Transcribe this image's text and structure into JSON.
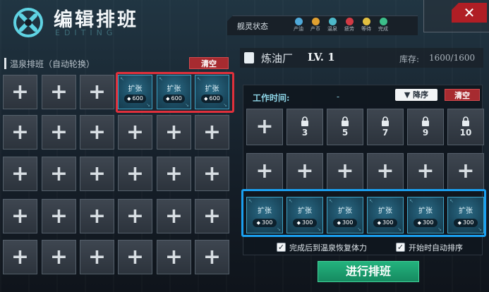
{
  "header": {
    "title": "编辑排班",
    "subtitle": "EDITING",
    "status_label": "舰灵状态",
    "status_items": [
      {
        "name": "产油",
        "icon": "oil-drop-icon",
        "color": "#4fa9d9"
      },
      {
        "name": "产币",
        "icon": "coin-icon",
        "color": "#e0a030"
      },
      {
        "name": "温泉",
        "icon": "hot-spring-icon",
        "color": "#4db8c9"
      },
      {
        "name": "疲劳",
        "icon": "fatigue-icon",
        "color": "#d23a44"
      },
      {
        "name": "等待",
        "icon": "hourglass-icon",
        "color": "#e2c040"
      },
      {
        "name": "完成",
        "icon": "check-circle-icon",
        "color": "#3cbf8a"
      }
    ],
    "close_symbol": "✕"
  },
  "left_panel": {
    "title": "温泉排班（自动轮换）",
    "clear_label": "清空",
    "expand_slots": [
      {
        "label": "扩张",
        "cost": "600"
      },
      {
        "label": "扩张",
        "cost": "600"
      },
      {
        "label": "扩张",
        "cost": "600"
      }
    ],
    "plus_symbol": "+"
  },
  "right_panel": {
    "factory_name": "炼油厂",
    "level": "LV. 1",
    "stock_label": "库存:",
    "stock_value": "1600/1600",
    "worktime_label": "工作时间:",
    "worktime_value": "-",
    "sort_label": "降序",
    "sort_arrow": "▼",
    "clear_label": "清空",
    "locked_slots": [
      "3",
      "5",
      "7",
      "9",
      "10"
    ],
    "expand_slots": [
      {
        "label": "扩张",
        "cost": "300"
      },
      {
        "label": "扩张",
        "cost": "300"
      },
      {
        "label": "扩张",
        "cost": "300"
      },
      {
        "label": "扩张",
        "cost": "300"
      },
      {
        "label": "扩张",
        "cost": "300"
      },
      {
        "label": "扩张",
        "cost": "300"
      }
    ],
    "option_restore": "完成后到温泉恢复体力",
    "option_autosort": "开始时自动排序",
    "option_restore_checked": true,
    "option_autosort_checked": true,
    "start_label": "进行排班"
  },
  "colors": {
    "accent_red": "#a72b30",
    "highlight_red": "#e0303b",
    "highlight_blue": "#1aa0f0",
    "start_green": "#23b37e"
  }
}
